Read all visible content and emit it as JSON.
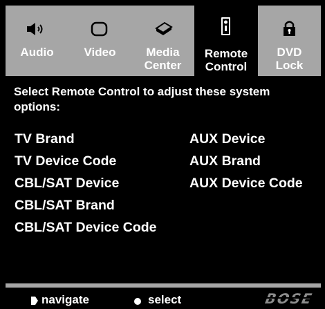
{
  "tabs": [
    {
      "id": "audio",
      "line1": "Audio",
      "line2": "",
      "icon": "speaker-icon",
      "active": false
    },
    {
      "id": "video",
      "line1": "Video",
      "line2": "",
      "icon": "display-icon",
      "active": false
    },
    {
      "id": "media-center",
      "line1": "Media",
      "line2": "Center",
      "icon": "media-center-icon",
      "active": false
    },
    {
      "id": "remote-control",
      "line1": "Remote",
      "line2": "Control",
      "icon": "remote-icon",
      "active": true
    },
    {
      "id": "dvd-lock",
      "line1": "DVD",
      "line2": "Lock",
      "icon": "lock-icon",
      "active": false
    }
  ],
  "panel": {
    "instructions": "Select Remote Control to adjust these system options:",
    "left_options": [
      "TV Brand",
      "TV Device Code",
      "CBL/SAT Device",
      "CBL/SAT Brand",
      "CBL/SAT Device Code"
    ],
    "right_options": [
      "AUX Device",
      "AUX Brand",
      "AUX Device Code"
    ]
  },
  "footer": {
    "navigate_label": "navigate",
    "select_label": "select",
    "brand": "BOSE"
  },
  "colors": {
    "tab_bar": "#a6a6a6",
    "background": "#000000",
    "text": "#ffffff"
  }
}
